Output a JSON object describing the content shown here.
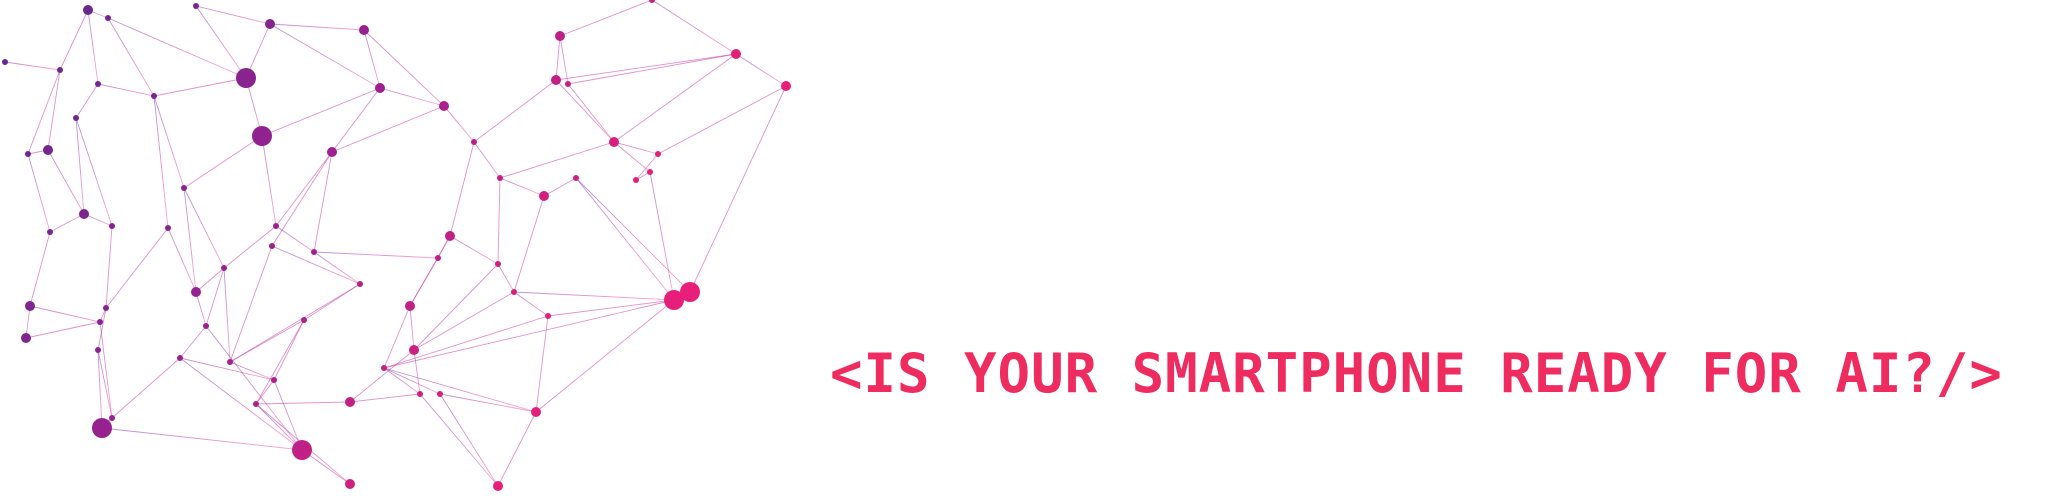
{
  "headline": {
    "text": "<IS YOUR SMARTPHONE READY FOR AI?/>",
    "color": "#ee2c5f"
  },
  "graphic": {
    "icon": "network-mesh-illustration",
    "colors": {
      "purple": "#6a2c94",
      "magenta": "#b0208f",
      "pink": "#ee1d7b"
    }
  }
}
